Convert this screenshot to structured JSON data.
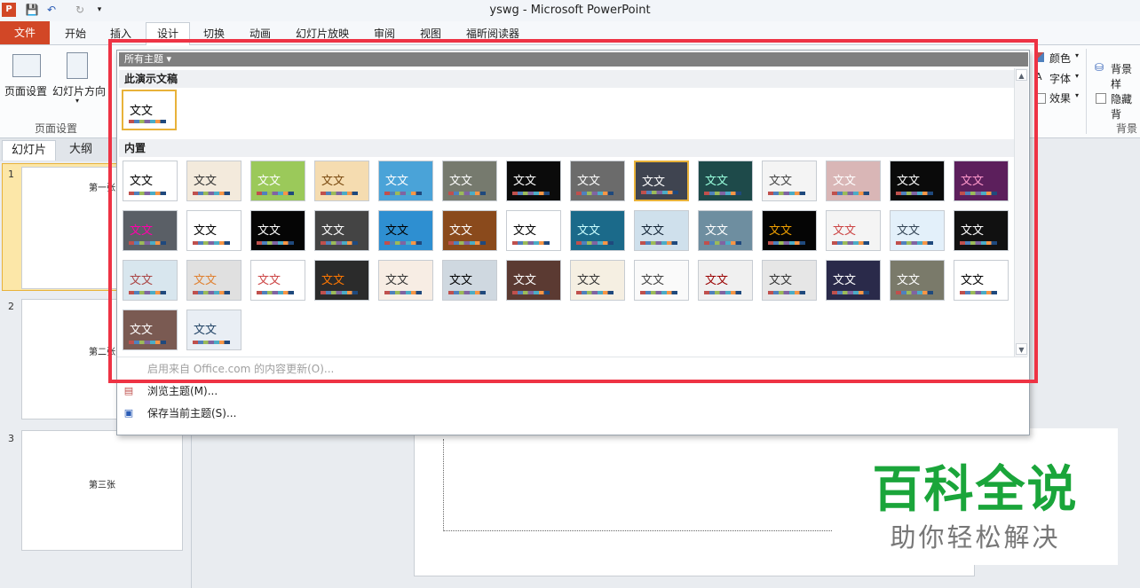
{
  "window": {
    "title": "yswg  -  Microsoft PowerPoint"
  },
  "tabs": [
    "开始",
    "插入",
    "设计",
    "切换",
    "动画",
    "幻灯片放映",
    "审阅",
    "视图",
    "福昕阅读器"
  ],
  "file_tab": "文件",
  "ribbon": {
    "page_setup": "页面设置",
    "slide_orientation": "幻灯片方向",
    "group_page_setup": "页面设置",
    "colors": "颜色",
    "fonts": "字体",
    "effects": "效果",
    "bg_styles": "背景样",
    "hide_bg": "隐藏背",
    "group_background": "背景"
  },
  "pane_tabs": {
    "slides": "幻灯片",
    "outline": "大纲"
  },
  "slides": [
    {
      "num": "1",
      "text": "第一张"
    },
    {
      "num": "2",
      "text": "第二张"
    },
    {
      "num": "3",
      "text": "第三张"
    }
  ],
  "panel": {
    "header": "所有主题",
    "section_this": "此演示文稿",
    "section_builtin": "内置",
    "thumb_text": "文文",
    "menu": {
      "update": "启用来自 Office.com 的内容更新(O)...",
      "browse": "浏览主题(M)...",
      "save": "保存当前主题(S)..."
    }
  },
  "watermark": {
    "title": "百科全说",
    "subtitle": "助你轻松解决"
  },
  "colors": {
    "file_tab": "#d24726",
    "highlight_box": "#ee3344",
    "watermark_green": "#1aa53a"
  }
}
